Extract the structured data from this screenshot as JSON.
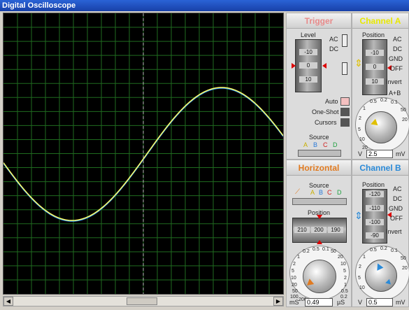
{
  "window": {
    "title": "Digital Oscilloscope"
  },
  "trigger": {
    "title": "Trigger",
    "level_label": "Level",
    "level_ticks": [
      "-10",
      "0",
      "10"
    ],
    "ac": "AC",
    "dc": "DC",
    "auto": "Auto",
    "oneshot": "One-Shot",
    "cursors": "Cursors",
    "source_label": "Source",
    "sources": [
      "A",
      "B",
      "C",
      "D"
    ]
  },
  "channel_a": {
    "title": "Channel A",
    "position_label": "Position",
    "position_ticks": [
      "-10",
      "0",
      "10"
    ],
    "modes": [
      "AC",
      "DC",
      "GND",
      "OFF"
    ],
    "invert": "Invert",
    "aplusb": "A+B",
    "dial_marks": [
      "0.5",
      "0.2",
      "0.1",
      "50",
      "1",
      "20",
      "2",
      "5",
      "10",
      "20"
    ],
    "unit_left": "V",
    "unit_right": "mV",
    "value": "2.5"
  },
  "horizontal": {
    "title": "Horizontal",
    "source_label": "Source",
    "sources": [
      "A",
      "B",
      "C",
      "D"
    ],
    "position_label": "Position",
    "position_ticks": [
      "210",
      "200",
      "190"
    ],
    "dial_marks": [
      "0.5",
      "0.2",
      "0.1",
      "50",
      "1",
      "20",
      "2",
      "10",
      "5",
      "5",
      "10",
      "2",
      "20",
      "1",
      "50",
      "0.5",
      "100",
      "0.2",
      "200"
    ],
    "unit_left": "mS",
    "unit_right": "µS",
    "value": "0.49"
  },
  "channel_b": {
    "title": "Channel B",
    "position_label": "Position",
    "position_ticks": [
      "-120",
      "-110",
      "-100",
      "-90"
    ],
    "modes": [
      "AC",
      "DC",
      "GND",
      "OFF"
    ],
    "invert": "Invert",
    "dial_marks": [
      "0.5",
      "0.2",
      "0.1",
      "50",
      "1",
      "20",
      "2",
      "5",
      "10"
    ],
    "unit_left": "V",
    "unit_right": "mV",
    "value": "0.5"
  },
  "scrollbar": {
    "left_arrow": "◀",
    "right_arrow": "▶"
  },
  "colors": {
    "trace_a": "#ffff66",
    "trace_b": "#3aa0ff",
    "grid": "#1f6b1f",
    "trigger_title": "#e88a8a",
    "channel_a_title": "#e8e800",
    "horizontal_title": "#e07a20",
    "channel_b_title": "#2a8ad8"
  }
}
